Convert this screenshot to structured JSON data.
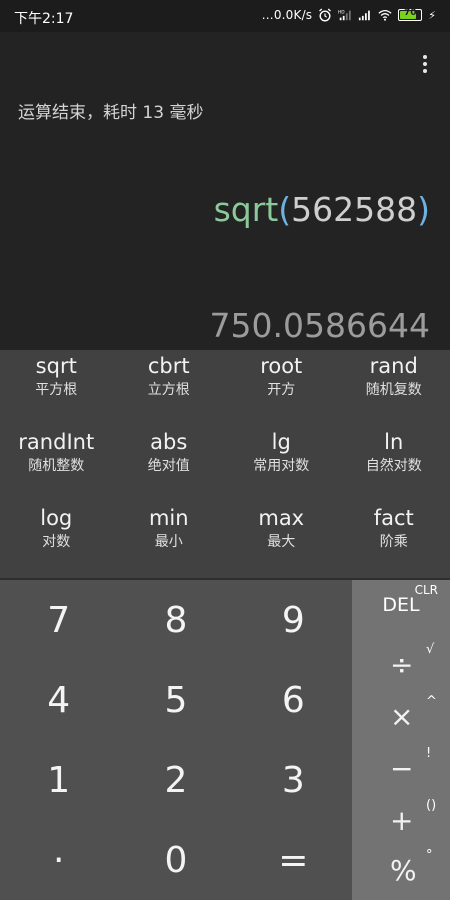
{
  "status_bar": {
    "time": "下午2:17",
    "network_speed": "0.0K/s",
    "hd_label": "HD",
    "battery": "70",
    "battery_level": 0.7,
    "accent_color": "#7cd11e"
  },
  "display": {
    "status_message": "运算结束，耗时 13 毫秒",
    "expression": {
      "function": "sqrt",
      "open_paren": "(",
      "argument": "562588",
      "close_paren": ")"
    },
    "result": "750.0586644",
    "menu_icon": "more-vertical-icon"
  },
  "functions": [
    {
      "name": "sqrt",
      "desc": "平方根"
    },
    {
      "name": "cbrt",
      "desc": "立方根"
    },
    {
      "name": "root",
      "desc": "开方"
    },
    {
      "name": "rand",
      "desc": "随机复数"
    },
    {
      "name": "randInt",
      "desc": "随机整数"
    },
    {
      "name": "abs",
      "desc": "绝对值"
    },
    {
      "name": "lg",
      "desc": "常用对数"
    },
    {
      "name": "ln",
      "desc": "自然对数"
    },
    {
      "name": "log",
      "desc": "对数"
    },
    {
      "name": "min",
      "desc": "最小"
    },
    {
      "name": "max",
      "desc": "最大"
    },
    {
      "name": "fact",
      "desc": "阶乘"
    }
  ],
  "numpad": [
    "7",
    "8",
    "9",
    "4",
    "5",
    "6",
    "1",
    "2",
    "3",
    "·",
    "0",
    "="
  ],
  "operators": {
    "clr": "CLR",
    "del": "DEL",
    "rows": [
      {
        "main": "÷",
        "sub": "√"
      },
      {
        "main": "×",
        "sub": "^"
      },
      {
        "main": "−",
        "sub": "!"
      },
      {
        "main": "+",
        "sub": "()"
      },
      {
        "main": "%",
        "sub": "°"
      }
    ]
  }
}
